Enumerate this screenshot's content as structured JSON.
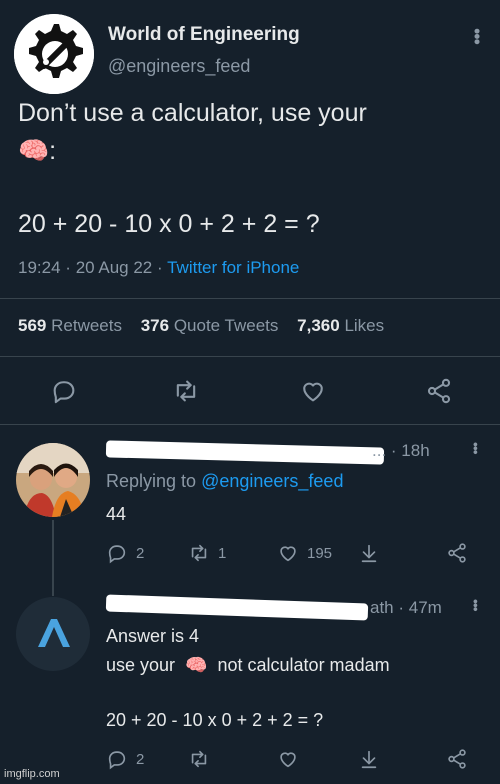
{
  "tweet": {
    "author_name": "World of Engineering",
    "author_handle": "@engineers_feed",
    "text_line1": "Don’t use a calculator, use your",
    "text_line2_emoji": "🧠",
    "text_line2_suffix": ":",
    "equation": "20 + 20 - 10 x 0 + 2 + 2 = ?",
    "time": "19:24",
    "date": "20 Aug 22",
    "separator": "·",
    "source": "Twitter for iPhone",
    "stats": {
      "retweets_count": "569",
      "retweets_label": "Retweets",
      "quotes_count": "376",
      "quotes_label": "Quote Tweets",
      "likes_count": "7,360",
      "likes_label": "Likes"
    },
    "actions": [
      "reply-icon",
      "retweet-icon",
      "like-icon",
      "share-icon"
    ]
  },
  "replies": [
    {
      "handle_suffix": "...",
      "time": "· 18h",
      "replying_prefix": "Replying to",
      "replying_handle": "@engineers_feed",
      "text": "44",
      "reply_count": "2",
      "retweet_count": "1",
      "like_count": "195"
    },
    {
      "handle_suffix": "ath · 47m",
      "text_line1": "Answer is 4",
      "text_line2_prefix": "use your",
      "text_line2_emoji": "🧠",
      "text_line2_suffix": "not calculator madam",
      "text_line3": "20 + 20 - 10 x 0 + 2 + 2 = ?",
      "reply_count": "2"
    }
  ],
  "watermark": "imgflip.com",
  "colors": {
    "background": "#15202b",
    "text": "#e7e9ea",
    "muted": "#8b98a5",
    "link": "#1d9bf0",
    "divider": "#38444d"
  }
}
